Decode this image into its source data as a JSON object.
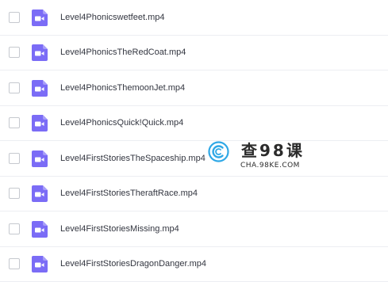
{
  "files": [
    {
      "name": "Level4Phonicswetfeet.mp4",
      "icon": "video-file-icon"
    },
    {
      "name": "Level4PhonicsTheRedCoat.mp4",
      "icon": "video-file-icon"
    },
    {
      "name": "Level4PhonicsThemoonJet.mp4",
      "icon": "video-file-icon"
    },
    {
      "name": "Level4PhonicsQuick!Quick.mp4",
      "icon": "video-file-icon"
    },
    {
      "name": "Level4FirstStoriesTheSpaceship.mp4",
      "icon": "video-file-icon"
    },
    {
      "name": "Level4FirstStoriesTheraftRace.mp4",
      "icon": "video-file-icon"
    },
    {
      "name": "Level4FirstStoriesMissing.mp4",
      "icon": "video-file-icon"
    },
    {
      "name": "Level4FirstStoriesDragonDanger.mp4",
      "icon": "video-file-icon"
    }
  ],
  "watermark": {
    "title": "查98课",
    "url": "CHA.98KE.COM",
    "logo_icon": "watermark-logo-icon"
  },
  "colors": {
    "video_icon": "#7b6cf6",
    "watermark_logo": "#2fa8e6",
    "text": "#333640",
    "divider": "#eceef2"
  }
}
